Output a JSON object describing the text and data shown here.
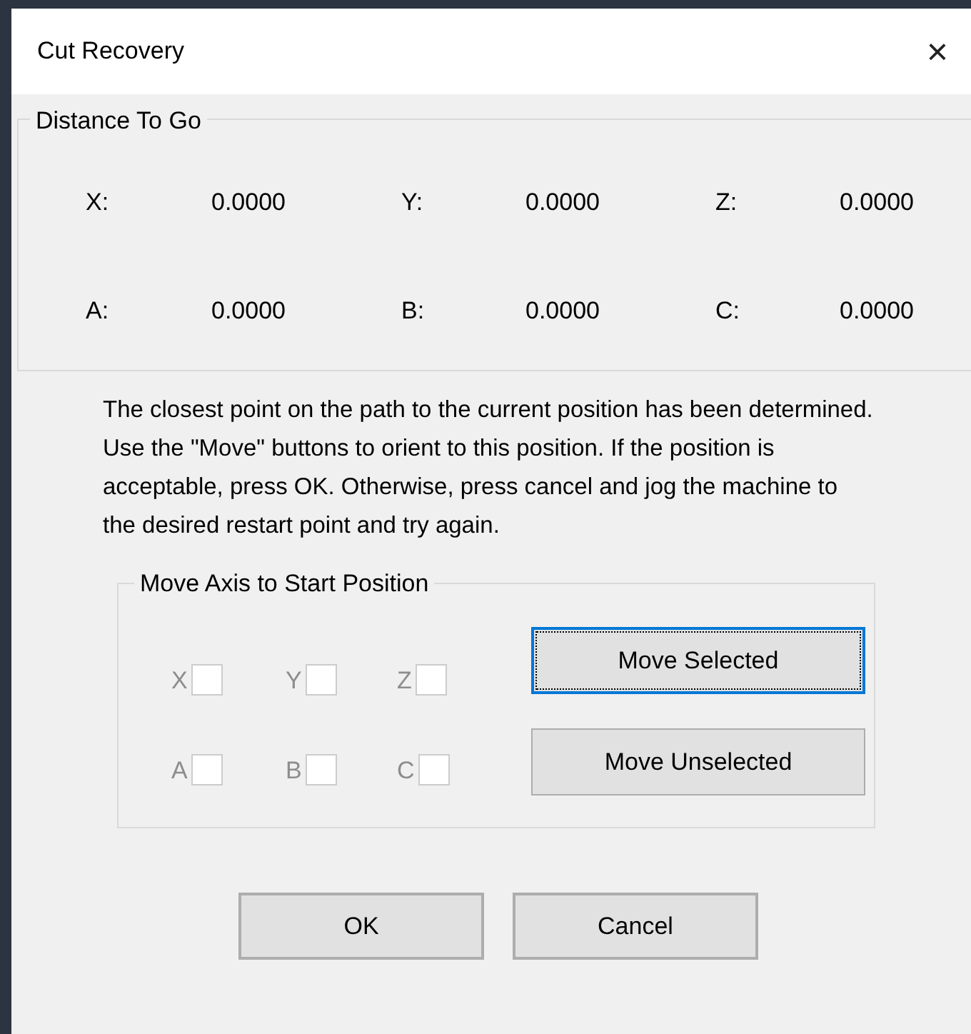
{
  "window": {
    "title": "Cut Recovery",
    "close": "×"
  },
  "distance_group": {
    "title": "Distance To Go",
    "axes": [
      {
        "label": "X:",
        "value": "0.0000"
      },
      {
        "label": "Y:",
        "value": "0.0000"
      },
      {
        "label": "Z:",
        "value": "0.0000"
      },
      {
        "label": "A:",
        "value": "0.0000"
      },
      {
        "label": "B:",
        "value": "0.0000"
      },
      {
        "label": "C:",
        "value": "0.0000"
      }
    ]
  },
  "message": "The closest point on the path to the current position has been determined.  Use the \"Move\" buttons to orient to this position.  If the position is acceptable, press OK.  Otherwise, press cancel and jog the machine to the desired restart point and try again.",
  "move_group": {
    "title": "Move Axis to Start Position",
    "checkboxes": [
      {
        "label": "X",
        "checked": false,
        "disabled": true
      },
      {
        "label": "Y",
        "checked": false,
        "disabled": true
      },
      {
        "label": "Z",
        "checked": false,
        "disabled": true
      },
      {
        "label": "A",
        "checked": false,
        "disabled": true
      },
      {
        "label": "B",
        "checked": false,
        "disabled": true
      },
      {
        "label": "C",
        "checked": false,
        "disabled": true
      }
    ],
    "buttons": [
      {
        "label": "Move Selected",
        "focused": true
      },
      {
        "label": "Move Unselected",
        "focused": false
      }
    ]
  },
  "buttons": [
    {
      "label": "OK"
    },
    {
      "label": "Cancel"
    }
  ]
}
